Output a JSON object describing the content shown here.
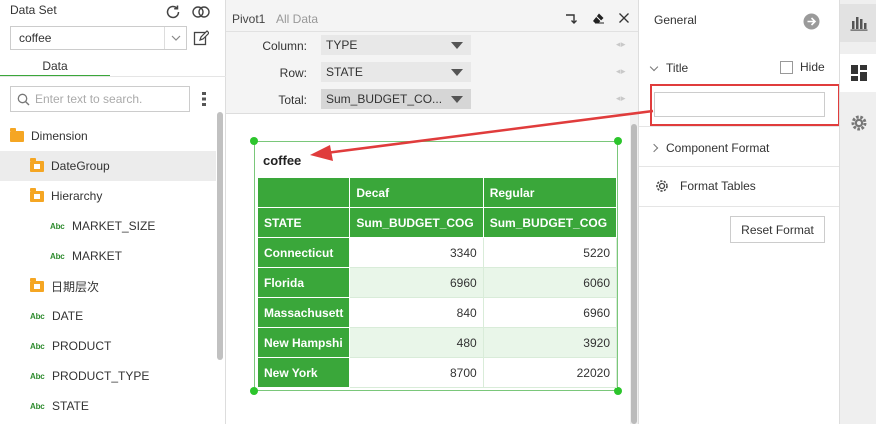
{
  "left_panel": {
    "dataset_label": "Data Set",
    "dataset_value": "coffee",
    "tab_label": "Data",
    "search_placeholder": "Enter text to search.",
    "tree": [
      {
        "label": "Dimension",
        "kind": "folder",
        "level": 0
      },
      {
        "label": "DateGroup",
        "kind": "folder-doc",
        "level": 1,
        "selected": true
      },
      {
        "label": "Hierarchy",
        "kind": "folder-doc",
        "level": 1
      },
      {
        "label": "MARKET_SIZE",
        "kind": "abc",
        "level": 2
      },
      {
        "label": "MARKET",
        "kind": "abc",
        "level": 2
      },
      {
        "label": "日期层次",
        "kind": "folder-doc",
        "level": 1
      },
      {
        "label": "DATE",
        "kind": "abc",
        "level": 1
      },
      {
        "label": "PRODUCT",
        "kind": "abc",
        "level": 1
      },
      {
        "label": "PRODUCT_TYPE",
        "kind": "abc",
        "level": 1
      },
      {
        "label": "STATE",
        "kind": "abc",
        "level": 1
      }
    ],
    "abc_badge": "Abc"
  },
  "center_panel": {
    "pivot_name": "Pivot1",
    "pivot_subtitle": "All Data",
    "fields": {
      "column": {
        "label": "Column:",
        "value": "TYPE"
      },
      "row": {
        "label": "Row:",
        "value": "STATE"
      },
      "total": {
        "label": "Total:",
        "value": "Sum_BUDGET_CO..."
      }
    },
    "field_arrows": "◂ ▸",
    "pivot": {
      "title": "coffee",
      "header_row1": [
        "",
        "Decaf",
        "Regular"
      ],
      "header_row2": [
        "STATE",
        "Sum_BUDGET_COG",
        "Sum_BUDGET_COG"
      ],
      "rows": [
        {
          "state": "Connecticut",
          "decaf": "3340",
          "regular": "5220"
        },
        {
          "state": "Florida",
          "decaf": "6960",
          "regular": "6060"
        },
        {
          "state": "Massachusett",
          "decaf": "840",
          "regular": "6960"
        },
        {
          "state": "New Hampshi",
          "decaf": "480",
          "regular": "3920"
        },
        {
          "state": "New York",
          "decaf": "8700",
          "regular": "22020"
        }
      ]
    }
  },
  "right_panel": {
    "general_title": "General",
    "title_section": "Title",
    "hide_label": "Hide",
    "title_input_value": "",
    "component_format": "Component Format",
    "format_tables": "Format Tables",
    "reset_format": "Reset Format"
  },
  "colors": {
    "accent_green": "#3aa73a",
    "highlight_red": "#e03c3c",
    "folder_orange": "#f5a623"
  }
}
